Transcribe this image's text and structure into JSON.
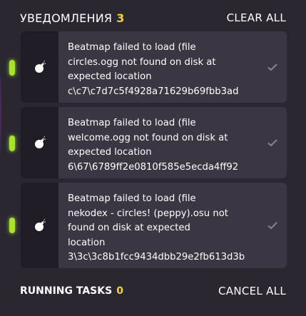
{
  "header": {
    "title": "УВЕДОМЛЕНИЯ",
    "count": "3",
    "clear_label": "CLEAR ALL"
  },
  "notifications": [
    {
      "message": "Beatmap failed to load (file\ncircles.ogg not found on disk at\nexpected location\nc\\c7\\c7d7c5f4928a71629b69fbb3ad",
      "icon": "bomb-icon",
      "status": "unread"
    },
    {
      "message": "Beatmap failed to load (file\nwelcome.ogg not found on disk at\nexpected location\n6\\67\\6789ff2e0810f585e5ecda4ff92",
      "icon": "bomb-icon",
      "status": "unread"
    },
    {
      "message": "Beatmap failed to load (file\nnekodex - circles! (peppy).osu not\nfound on disk at expected\nlocation\n3\\3c\\3c8b1fcc9434dbb29e2fb613d3b",
      "icon": "bomb-icon",
      "status": "unread"
    }
  ],
  "footer": {
    "title": "RUNNING TASKS",
    "count": "0",
    "cancel_label": "CANCEL ALL"
  },
  "colors": {
    "accent_yellow": "#f5d23a",
    "unread_pip": "#a6e22e",
    "card": "#3b3642",
    "icon_bg": "#1f1c25"
  }
}
